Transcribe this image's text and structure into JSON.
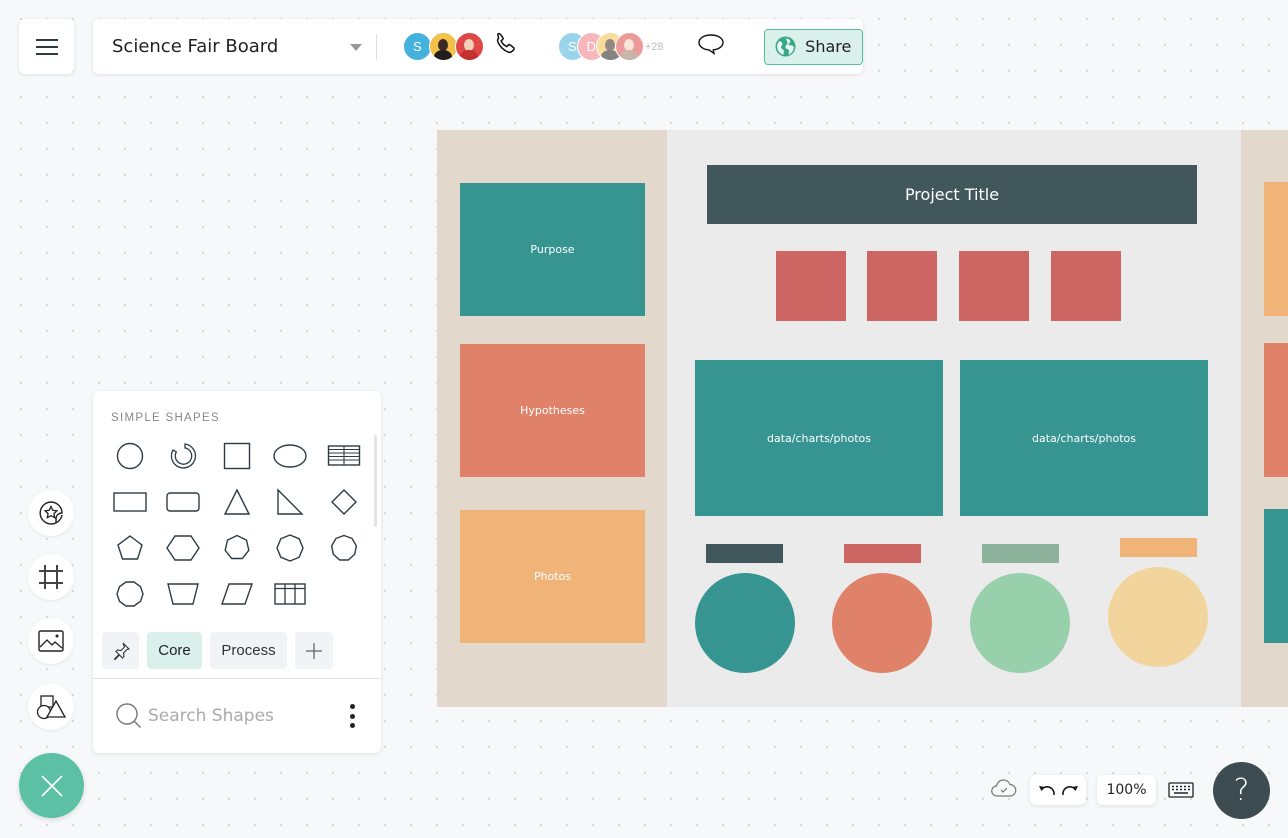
{
  "header": {
    "menu_icon": "hamburger-icon",
    "document_title": "Science Fair Board",
    "title_dropdown_icon": "caret-down-icon",
    "call_participants": [
      {
        "initial": "S",
        "color": "#45b1dd",
        "type": "initial"
      },
      {
        "initial": "",
        "color": "#f4c04c",
        "type": "photo"
      },
      {
        "initial": "",
        "color": "#e04848",
        "type": "photo"
      }
    ],
    "call_icon": "phone-icon",
    "collaborators": [
      {
        "initial": "S",
        "color": "#45b1dd",
        "type": "initial"
      },
      {
        "initial": "D",
        "color": "#ef7c84",
        "type": "initial"
      },
      {
        "initial": "",
        "color": "#f4c04c",
        "type": "photo"
      },
      {
        "initial": "",
        "color": "#e04848",
        "type": "photo"
      }
    ],
    "collaborators_more": "+28",
    "comments_icon": "chat-bubble-icon",
    "share_label": "Share",
    "share_icon": "globe-icon"
  },
  "board": {
    "colors": {
      "teal": "#369590",
      "coral": "#df8269",
      "orange": "#f0b479",
      "slate": "#42575c",
      "red": "#cd6663",
      "sage": "#8db29b",
      "mint": "#97d0ab",
      "cream": "#f2d59d",
      "panel": "#e2d8cb",
      "center": "#ebebeb"
    },
    "project_title": "Project Title",
    "left_blocks": [
      "Purpose",
      "Hypotheses",
      "Photos"
    ],
    "media_blocks": [
      "data/charts/photos",
      "data/charts/photos"
    ]
  },
  "tool_rail": {
    "buttons": [
      {
        "name": "templates",
        "icon": "sticker-star-icon"
      },
      {
        "name": "frames",
        "icon": "frame-grid-icon"
      },
      {
        "name": "images",
        "icon": "image-icon"
      },
      {
        "name": "shapes",
        "icon": "shapes-icon"
      }
    ],
    "close_icon": "close-icon"
  },
  "shapes_panel": {
    "heading": "SIMPLE SHAPES",
    "shapes": [
      "circle",
      "ring",
      "square",
      "ellipse",
      "striped-table",
      "rectangle",
      "rounded-rectangle",
      "triangle",
      "right-triangle",
      "diamond",
      "pentagon",
      "hexagon",
      "heptagon",
      "octagon",
      "nonagon",
      "decagon",
      "trapezoid",
      "parallelogram",
      "table"
    ],
    "tabs": [
      {
        "label": "",
        "icon": "pin-icon",
        "active": false
      },
      {
        "label": "Core",
        "active": true
      },
      {
        "label": "Process",
        "active": false
      },
      {
        "label": "",
        "icon": "plus-icon",
        "active": false
      }
    ],
    "search": {
      "placeholder": "Search Shapes",
      "value": ""
    },
    "more_icon": "kebab-menu-icon"
  },
  "bottom_bar": {
    "save_status_icon": "cloud-saved-icon",
    "undo_icon": "undo-icon",
    "redo_icon": "redo-icon",
    "zoom_level": "100%",
    "keyboard_icon": "keyboard-icon",
    "help_label": "?"
  }
}
